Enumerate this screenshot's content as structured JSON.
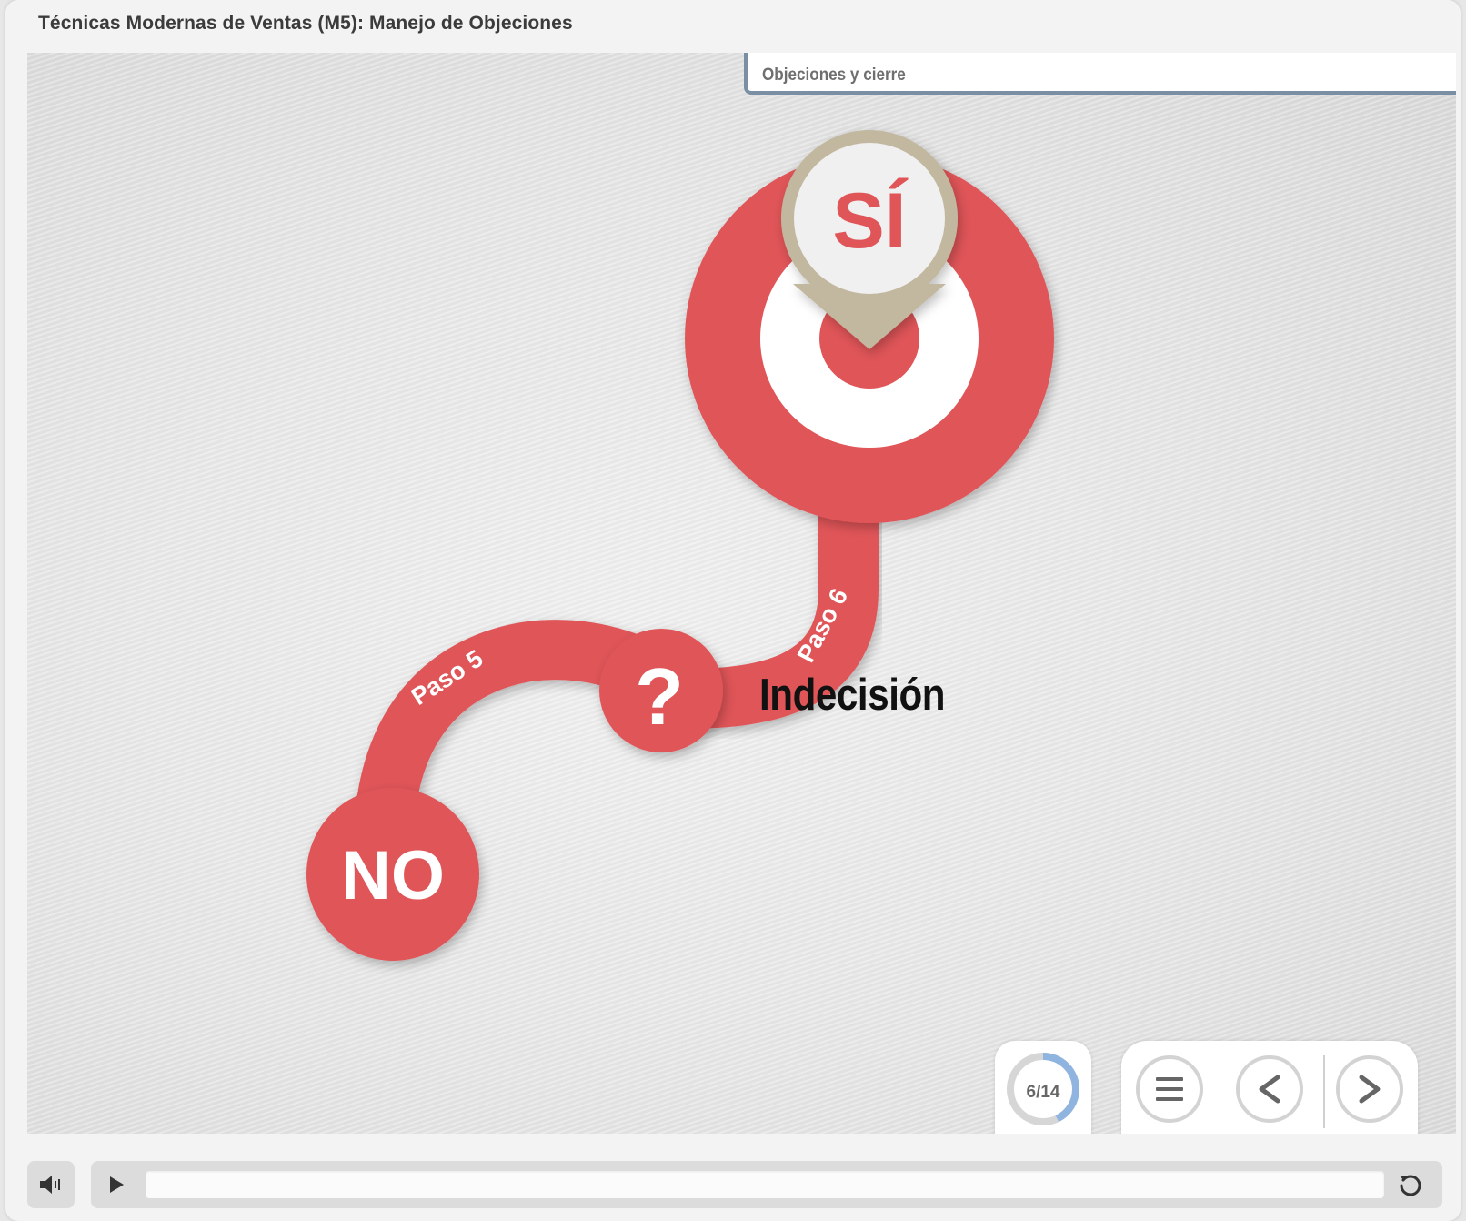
{
  "course": {
    "title": "Técnicas Modernas de Ventas (M5): Manejo de Objeciones"
  },
  "section": {
    "label": "Objeciones y cierre"
  },
  "diagram": {
    "yes_label": "SÍ",
    "no_label": "NO",
    "question_mark": "?",
    "step5_label": "Paso 5",
    "step6_label": "Paso 6",
    "indecision_label": "Indecisión"
  },
  "progress": {
    "text": "6/14",
    "current": 6,
    "total": 14
  },
  "navigation": {
    "menu_icon": "hamburger-menu-icon",
    "prev_icon": "chevron-left-icon",
    "next_icon": "chevron-right-icon"
  },
  "player": {
    "volume_icon": "speaker-icon",
    "play_icon": "play-icon",
    "replay_icon": "replay-icon"
  },
  "colors": {
    "accent_red": "#e05558",
    "pin_tan": "#c2b79f",
    "section_border": "#7a8ea4",
    "progress_fill": "#8fb4e0",
    "progress_track": "#d6d6d6"
  }
}
